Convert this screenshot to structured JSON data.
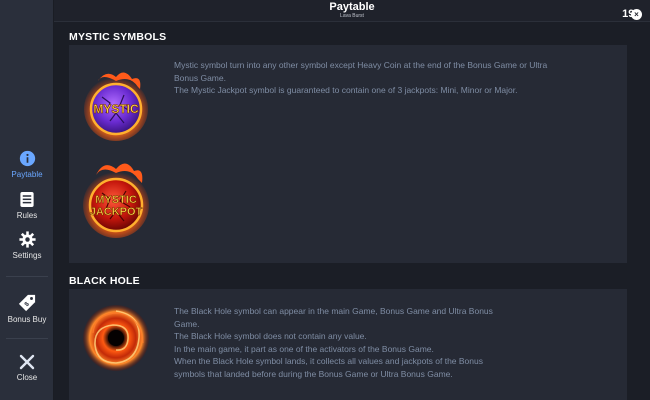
{
  "header": {
    "title": "Paytable",
    "subtitle": "Lava Burst",
    "clock": "19:"
  },
  "sidebar": {
    "items": [
      {
        "label": "Paytable",
        "icon": "info-icon",
        "active": true
      },
      {
        "label": "Rules",
        "icon": "rules-list-icon",
        "active": false
      },
      {
        "label": "Settings",
        "icon": "gear-icon",
        "active": false
      },
      {
        "label": "Bonus Buy",
        "icon": "price-tag-icon",
        "active": false
      },
      {
        "label": "Close",
        "icon": "close-icon",
        "active": false
      }
    ]
  },
  "sections": {
    "mystic": {
      "title": "MYSTIC SYMBOLS",
      "symbol1_text": "MYSTIC",
      "symbol2_line1": "MYSTIC",
      "symbol2_line2": "JACKPOT",
      "lines": [
        "Mystic symbol turn into any other symbol except Heavy Coin at the end of the Bonus Game or Ultra",
        "Bonus Game.",
        "The Mystic Jackpot symbol is guaranteed to contain one of 3 jackpots: Mini, Minor or Major."
      ]
    },
    "blackhole": {
      "title": "BLACK HOLE",
      "lines": [
        "The Black Hole symbol can appear in the main Game, Bonus Game and Ultra Bonus",
        "Game.",
        "The Black Hole symbol does not contain any value.",
        "In the main game, it part as one of the activators of the Bonus Game.",
        "When the Black Hole symbol lands, it collects all values and jackpots of the Bonus",
        "symbols that landed before during the Bonus Game or Ultra Bonus Game."
      ]
    }
  },
  "colors": {
    "accent": "#6aa7ff",
    "text_muted": "#7f8da4",
    "sidebar_bg": "#2a2f3b",
    "card_bg": "#262a35"
  }
}
